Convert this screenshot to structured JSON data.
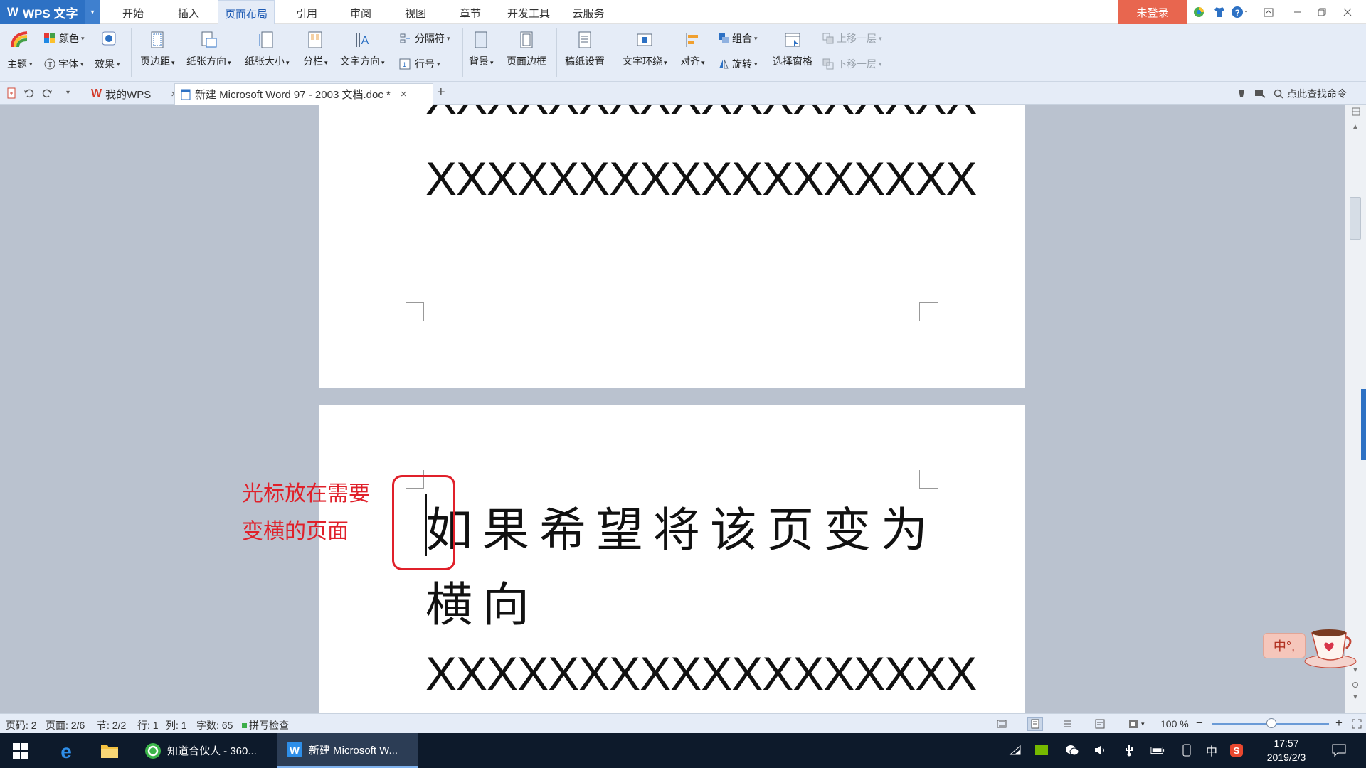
{
  "app": {
    "name": "WPS 文字",
    "logo_glyph": "W",
    "dropdown_glyph": "▾"
  },
  "menu_tabs": [
    "开始",
    "插入",
    "页面布局",
    "引用",
    "审阅",
    "视图",
    "章节",
    "开发工具",
    "云服务"
  ],
  "active_menu_tab": "页面布局",
  "login_label": "未登录",
  "ribbon": {
    "theme": {
      "color": "颜色",
      "theme": "主题",
      "font": "字体",
      "effect": "效果"
    },
    "page_setup": {
      "margins": "页边距",
      "orientation": "纸张方向",
      "size": "纸张大小",
      "columns": "分栏",
      "text_direction": "文字方向",
      "breaks": "分隔符",
      "line_numbers": "行号"
    },
    "background": {
      "background": "背景",
      "page_border": "页面边框"
    },
    "manuscript": "稿纸设置",
    "arrange": {
      "text_wrap": "文字环绕",
      "align": "对齐",
      "group": "组合",
      "rotate": "旋转",
      "selection_pane": "选择窗格",
      "bring_forward": "上移一层",
      "send_backward": "下移一层"
    }
  },
  "doc_tabs": {
    "home_tab": "我的WPS",
    "doc_tab": "新建 Microsoft Word 97 - 2003 文档.doc *",
    "close_glyph": "×",
    "new_tab_glyph": "+"
  },
  "search_command": "点此查找命令",
  "document": {
    "top_line_partial": "XXXXXXXXXXXXXXXXXX",
    "top_line": "XXXXXXXXXXXXXXXXXX",
    "page2_line1": "如果希望将该页变为",
    "page2_line2": "横向",
    "page2_line3": "XXXXXXXXXXXXXXXXXX"
  },
  "annotation": {
    "line1": "光标放在需要",
    "line2": "变横的页面",
    "color": "#e0202a"
  },
  "status": {
    "page_code": "页码: 2",
    "pages": "页面: 2/6",
    "section": "节: 2/2",
    "row": "行: 1",
    "col": "列: 1",
    "word_count": "字数: 65",
    "spell_check": "拼写检查",
    "zoom": "100 %",
    "zoom_minus": "−",
    "zoom_plus": "+"
  },
  "taskbar": {
    "app1": "知道合伙人 - 360...",
    "app2": "新建 Microsoft W...",
    "ime": "中",
    "time": "17:57",
    "date": "2019/2/3"
  },
  "ime_float": "中°,",
  "colors": {
    "accent": "#2d71c4",
    "ribbon_bg": "#e5ecf7",
    "login": "#e8664f",
    "workspace": "#bac2cf",
    "taskbar": "#0d1a2b"
  }
}
